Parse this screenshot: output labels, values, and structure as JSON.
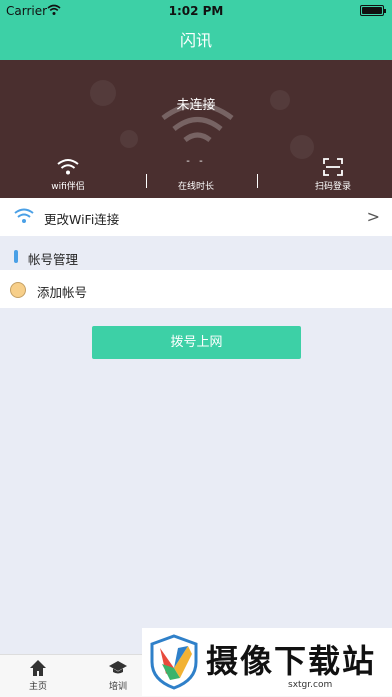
{
  "status_bar": {
    "carrier": "Carrier",
    "time": "1:02 PM",
    "battery_level": 1.0
  },
  "nav": {
    "title": "闪讯"
  },
  "hero": {
    "connection_status": "未连接",
    "duration_value": "- -",
    "items": [
      {
        "label": "wifi伴侣",
        "icon": "wifi-icon"
      },
      {
        "label": "在线时长"
      },
      {
        "label": "扫码登录",
        "icon": "scan-icon"
      }
    ]
  },
  "wifi_row": {
    "label": "更改WiFi连接",
    "chevron": ">"
  },
  "accounts": {
    "title": "帐号管理",
    "add_label": "添加帐号"
  },
  "dial_button": {
    "label": "拨号上网"
  },
  "tabbar": {
    "items": [
      {
        "label": "主页",
        "icon": "home-icon"
      },
      {
        "label": "培训",
        "icon": "graduation-cap-icon"
      }
    ]
  },
  "watermark": {
    "brand": "摄像下载站",
    "url": "sxtgr.com"
  },
  "colors": {
    "accent": "#3dd0a6",
    "hero_bg": "#4a2f2f",
    "page_bg": "#e9ecf5",
    "wifi_blue": "#4aa0e6"
  }
}
